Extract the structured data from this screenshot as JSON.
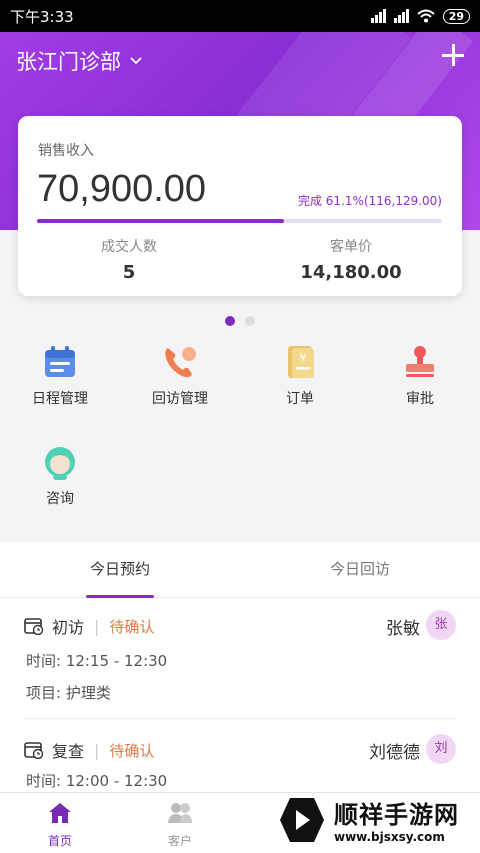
{
  "status_bar": {
    "time": "下午3:33",
    "battery": "29"
  },
  "header": {
    "clinic_name": "张江门诊部"
  },
  "sales_card": {
    "label": "销售收入",
    "amount": "70,900.00",
    "progress_text": "完成 61.1%(116,129.00)",
    "progress_fraction": 0.611,
    "stats": [
      {
        "label": "成交人数",
        "value": "5"
      },
      {
        "label": "客单价",
        "value": "14,180.00"
      }
    ]
  },
  "menu": [
    {
      "label": "日程管理",
      "icon": "calendar-icon"
    },
    {
      "label": "回访管理",
      "icon": "phone-icon"
    },
    {
      "label": "订单",
      "icon": "order-icon"
    },
    {
      "label": "审批",
      "icon": "stamp-icon"
    },
    {
      "label": "咨询",
      "icon": "consultant-icon"
    }
  ],
  "tabs": [
    {
      "label": "今日预约",
      "active": true
    },
    {
      "label": "今日回访",
      "active": false
    }
  ],
  "appointments": [
    {
      "type": "初访",
      "status": "待确认",
      "name": "张敏",
      "avatar": "张",
      "time": "时间: 12:15 - 12:30",
      "item": "项目: 护理类"
    },
    {
      "type": "复查",
      "status": "待确认",
      "name": "刘德德",
      "avatar": "刘",
      "time": "时间: 12:00 - 12:30"
    }
  ],
  "bottom_nav": [
    {
      "label": "首页",
      "active": true,
      "icon": "home-icon"
    },
    {
      "label": "客户",
      "active": false,
      "icon": "customers-icon"
    }
  ],
  "watermark": {
    "name": "顺祥手游网",
    "url": "www.bjsxsy.com"
  },
  "colors": {
    "primary": "#8a2bc6",
    "pending": "#e27a45"
  }
}
